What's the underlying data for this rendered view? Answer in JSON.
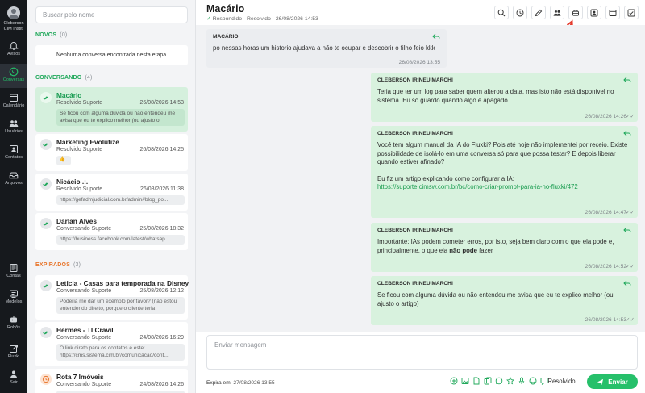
{
  "sidebar": {
    "user": {
      "line1": "Cleberson",
      "line2": "CIM Instit."
    },
    "items": [
      {
        "label": "Avisos",
        "icon": "bell-icon"
      },
      {
        "label": "Conversas",
        "icon": "whatsapp-icon",
        "active": true
      },
      {
        "label": "Calendário",
        "icon": "calendar-icon"
      },
      {
        "label": "Usuários",
        "icon": "users-icon"
      },
      {
        "label": "Contatos",
        "icon": "contacts-icon"
      },
      {
        "label": "Arquivos",
        "icon": "archive-icon"
      },
      {
        "label": "Contas",
        "icon": "accounts-icon"
      },
      {
        "label": "Modelos",
        "icon": "templates-icon"
      },
      {
        "label": "Robôs",
        "icon": "robot-icon"
      },
      {
        "label": "Fluxki",
        "icon": "external-link-icon"
      },
      {
        "label": "Sair",
        "icon": "logout-icon"
      }
    ]
  },
  "list": {
    "search_placeholder": "Buscar pelo nome",
    "novos": {
      "label": "NOVOS",
      "count": "(0)",
      "empty": "Nenhuma conversa encontrada nesta etapa"
    },
    "conversando": {
      "label": "CONVERSANDO",
      "count": "(4)",
      "items": [
        {
          "name": "Macário",
          "status": "Resolvido Suporte",
          "date": "26/08/2026 14:53",
          "preview": "Se ficou com alguma dúvida ou não entendeu me avisa que eu te explico melhor (ou ajusto o"
        },
        {
          "name": "Marketing Evolutize",
          "status": "Resolvido Suporte",
          "date": "26/08/2026 14:25",
          "preview": "👍"
        },
        {
          "name": "Nicácio .:.",
          "status": "Resolvido Suporte",
          "date": "26/08/2026 11:38",
          "preview": "https://gefadmjudicial.com.br/admin#blog_po..."
        },
        {
          "name": "Darlan Alves",
          "status": "Conversando Suporte",
          "date": "25/08/2026 18:32",
          "preview": "https://business.facebook.com/latest/whatsap..."
        }
      ]
    },
    "expirados": {
      "label": "EXPIRADOS",
      "count": "(3)",
      "items": [
        {
          "name": "Leticia - Casas para temporada na Disney",
          "status": "Conversando Suporte",
          "date": "25/08/2026 12:12",
          "preview": "Poderia me dar um exemplo por favor? (não estou entendendo direito, porque o cliente teria"
        },
        {
          "name": "Hermes - TI Cravil",
          "status": "Conversando Suporte",
          "date": "24/08/2026 16:29",
          "preview": "O link direto para os contatos é este: https://cms.sistema.cim.br/comunicacao/cont..."
        },
        {
          "name": "Rota 7 Imóveis",
          "status": "Conversando Suporte",
          "date": "24/08/2026 14:26",
          "preview": ""
        }
      ]
    }
  },
  "header": {
    "title": "Macário",
    "subtitle": "Respondido - Resolvido - 26/08/2026 14:53",
    "toolbar_icons": [
      "search-icon",
      "clock-icon",
      "pencil-icon",
      "transfer-users-icon",
      "bot-icon",
      "contact-card-icon",
      "window-icon",
      "checkbox-icon"
    ]
  },
  "messages": [
    {
      "direction": "in",
      "author": "MACÁRIO",
      "paragraphs": [
        "po nessas horas um historio ajudava a não te ocupar e descobrir o filho feio kkk"
      ],
      "time": "26/08/2026 13:55"
    },
    {
      "direction": "out",
      "author": "CLEBERSON IRINEU MARCHI",
      "paragraphs": [
        "Teria que ter um log para saber quem alterou a data, mas isto não está disponível no sistema. Eu só guardo quando algo é apagado"
      ],
      "time": "26/08/2026 14:26"
    },
    {
      "direction": "out",
      "author": "CLEBERSON IRINEU MARCHI",
      "paragraphs": [
        "Você tem algum manual da IA do Fluxki? Pois até hoje não implementei por receio. Existe possibilidade de isolá-lo em uma conversa só para que possa testar? E depois liberar quando estiver afinado?",
        "Eu fiz um artigo explicando como configurar a IA:"
      ],
      "link": "https://suporte.cimsw.com.br/bc/como-criar-prompt-para-ia-no-fluxki/472",
      "time": "26/08/2026 14:47"
    },
    {
      "direction": "out",
      "author": "CLEBERSON IRINEU MARCHI",
      "text_before": "Importante: IAs podem cometer erros, por isto, seja bem claro com o que ela pode e, principalmente, o que ela ",
      "text_bold": "não pode",
      "text_after": " fazer",
      "time": "26/08/2026 14:52"
    },
    {
      "direction": "out",
      "author": "CLEBERSON IRINEU MARCHI",
      "paragraphs": [
        "Se ficou com alguma dúvida ou não entendeu me avisa que eu te explico melhor (ou ajusto o artigo)"
      ],
      "time": "26/08/2026 14:53"
    }
  ],
  "composer": {
    "placeholder": "Enviar mensagem",
    "expires_label": "Expira em:",
    "expires_value": "27/08/2026 13:55",
    "resolvido_label": "Resolvido",
    "send_label": "Enviar"
  },
  "colors": {
    "accent": "#26c06a",
    "sidebar_bg": "#16191d",
    "out_bubble": "#d8f2de",
    "warning": "#e8772e"
  }
}
